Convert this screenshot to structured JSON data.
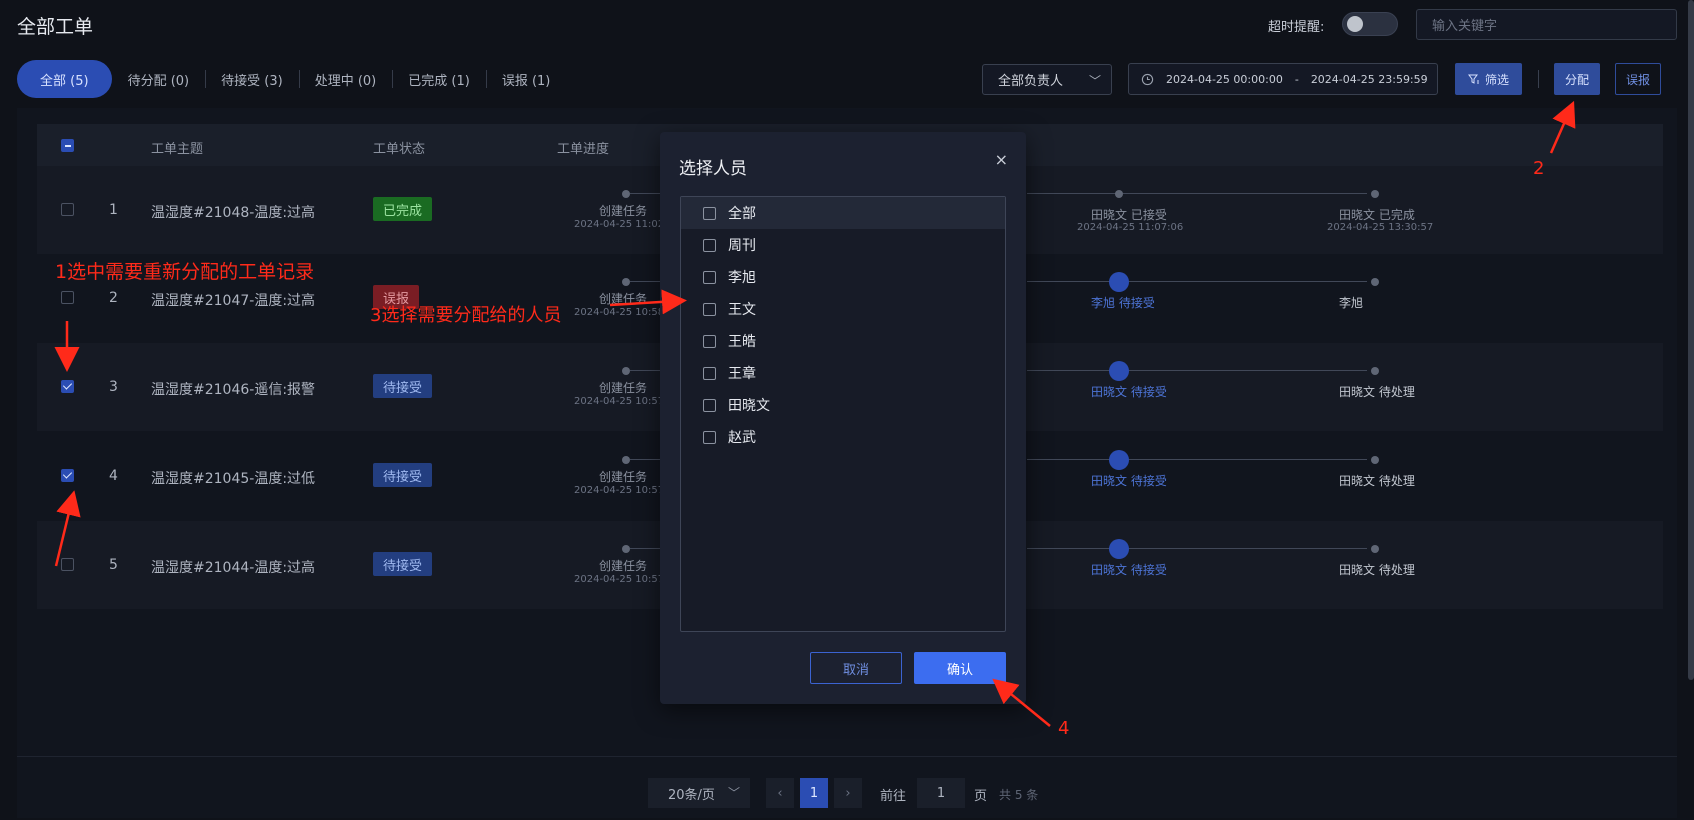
{
  "header": {
    "title": "全部工单",
    "timeout_label": "超时提醒:",
    "search_placeholder": "输入关键字"
  },
  "tabs": [
    {
      "label": "全部 (5)",
      "active": true
    },
    {
      "label": "待分配 (0)"
    },
    {
      "label": "待接受 (3)"
    },
    {
      "label": "处理中 (0)"
    },
    {
      "label": "已完成 (1)"
    },
    {
      "label": "误报 (1)"
    }
  ],
  "toolbar": {
    "assignee": "全部负责人",
    "date_start": "2024-04-25 00:00:00",
    "date_sep": "-",
    "date_end": "2024-04-25 23:59:59",
    "filter_label": "筛选",
    "assign_label": "分配",
    "false_label": "误报"
  },
  "table": {
    "columns": [
      "工单主题",
      "工单状态",
      "工单进度"
    ],
    "rows": [
      {
        "idx": "1",
        "subject": "温湿度#21048-温度:过高",
        "status": "已完成",
        "status_type": "done",
        "checked": false,
        "s1": "创建任务",
        "t1": "2024-04-25 11:02",
        "s2": "田晓文 已接受",
        "t2": "2024-04-25 11:07:06",
        "s3": "田晓文 已完成",
        "t3": "2024-04-25 13:30:57"
      },
      {
        "idx": "2",
        "subject": "温湿度#21047-温度:过高",
        "status": "误报",
        "status_type": "err",
        "checked": false,
        "s1": "创建任务",
        "t1": "2024-04-25 10:58",
        "s2": "李旭 待接受",
        "t2": "",
        "s3": "李旭",
        "t3": ""
      },
      {
        "idx": "3",
        "subject": "温湿度#21046-遥信:报警",
        "status": "待接受",
        "status_type": "wait",
        "checked": true,
        "s1": "创建任务",
        "t1": "2024-04-25 10:57",
        "s2": "田晓文 待接受",
        "t2": "",
        "s3": "田晓文 待处理",
        "t3": ""
      },
      {
        "idx": "4",
        "subject": "温湿度#21045-温度:过低",
        "status": "待接受",
        "status_type": "wait",
        "checked": true,
        "s1": "创建任务",
        "t1": "2024-04-25 10:57",
        "s2": "田晓文 待接受",
        "t2": "",
        "s3": "田晓文 待处理",
        "t3": ""
      },
      {
        "idx": "5",
        "subject": "温湿度#21044-温度:过高",
        "status": "待接受",
        "status_type": "wait",
        "checked": false,
        "s1": "创建任务",
        "t1": "2024-04-25 10:57",
        "s2": "田晓文 待接受",
        "t2": "",
        "s3": "田晓文 待处理",
        "t3": ""
      }
    ]
  },
  "pagination": {
    "page_size": "20条/页",
    "prev": "‹",
    "current": "1",
    "next": "›",
    "goto_label": "前往",
    "goto_value": "1",
    "page_unit": "页",
    "total": "共 5 条"
  },
  "dialog": {
    "title": "选择人员",
    "close": "×",
    "options": [
      "全部",
      "周刊",
      "李旭",
      "王文",
      "王皓",
      "王章",
      "田晓文",
      "赵武"
    ],
    "cancel": "取消",
    "confirm": "确认"
  },
  "annotations": {
    "step1": "1选中需要重新分配的工单记录",
    "step2": "2",
    "step3": "3选择需要分配给的人员",
    "step4": "4"
  },
  "colors": {
    "accent": "#2b4db3",
    "annotation": "#ff2a1a",
    "done": "#1a6b22",
    "error": "#7a1d24"
  }
}
